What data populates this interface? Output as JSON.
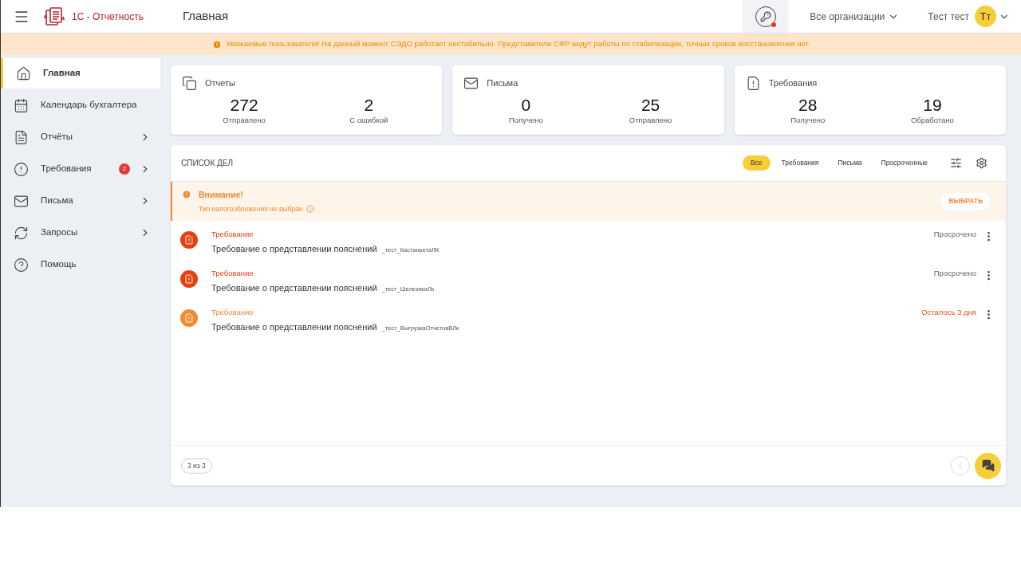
{
  "header": {
    "app_name": "1С - Отчетность",
    "page_title": "Главная",
    "org_selector": "Все организации",
    "user_name": "Тест тест",
    "avatar_initials": "Тт",
    "key_alert": true
  },
  "banner": "Уважаемые пользователи! На данный момент СЭДО работает нестабильно. Представители СФР ведут работы по стабилизации, точных сроков восстановления нет.",
  "sidebar": {
    "items": [
      {
        "label": "Главная",
        "selected": true,
        "expandable": false
      },
      {
        "label": "Календарь бухгалтера",
        "selected": false,
        "expandable": false
      },
      {
        "label": "Отчёты",
        "selected": false,
        "expandable": true
      },
      {
        "label": "Требования",
        "selected": false,
        "expandable": true,
        "badge": "2"
      },
      {
        "label": "Письма",
        "selected": false,
        "expandable": true
      },
      {
        "label": "Запросы",
        "selected": false,
        "expandable": true
      },
      {
        "label": "Помощь",
        "selected": false,
        "expandable": false
      }
    ]
  },
  "stats": [
    {
      "title": "Отчеты",
      "values": [
        {
          "number": "272",
          "label": "Отправлено"
        },
        {
          "number": "2",
          "label": "С ошибкой"
        }
      ]
    },
    {
      "title": "Письма",
      "values": [
        {
          "number": "0",
          "label": "Получено"
        },
        {
          "number": "25",
          "label": "Отправлено"
        }
      ]
    },
    {
      "title": "Требования",
      "values": [
        {
          "number": "28",
          "label": "Получено"
        },
        {
          "number": "19",
          "label": "Обработано"
        }
      ]
    }
  ],
  "todo": {
    "title": "СПИСОК ДЕЛ",
    "filters": [
      {
        "label": "Все",
        "selected": true
      },
      {
        "label": "Требования",
        "selected": false
      },
      {
        "label": "Письма",
        "selected": false
      },
      {
        "label": "Просроченные",
        "selected": false
      }
    ],
    "warning": {
      "title": "Внимание!",
      "text": "Тип налогообложения не выбран",
      "button": "ВЫБРАТЬ"
    },
    "items": [
      {
        "type": "Требование",
        "title": "Требование о представлении пояснений",
        "org": "_тест_КастаньетаЛК",
        "status": "Просрочено",
        "overdue": true,
        "color": "#e8400c"
      },
      {
        "type": "Требование",
        "title": "Требование о представлении пояснений",
        "org": "_тест_ШелезякаЛк",
        "status": "Просрочено",
        "overdue": true,
        "color": "#e8400c"
      },
      {
        "type": "Требование",
        "title": "Требование о представлении пояснений",
        "org": "_тест_ВыгрузкаОтчетовВЛк",
        "status": "Осталось 3 дня",
        "overdue": false,
        "color": "#f4892f"
      }
    ],
    "pager": "3 из 3"
  }
}
